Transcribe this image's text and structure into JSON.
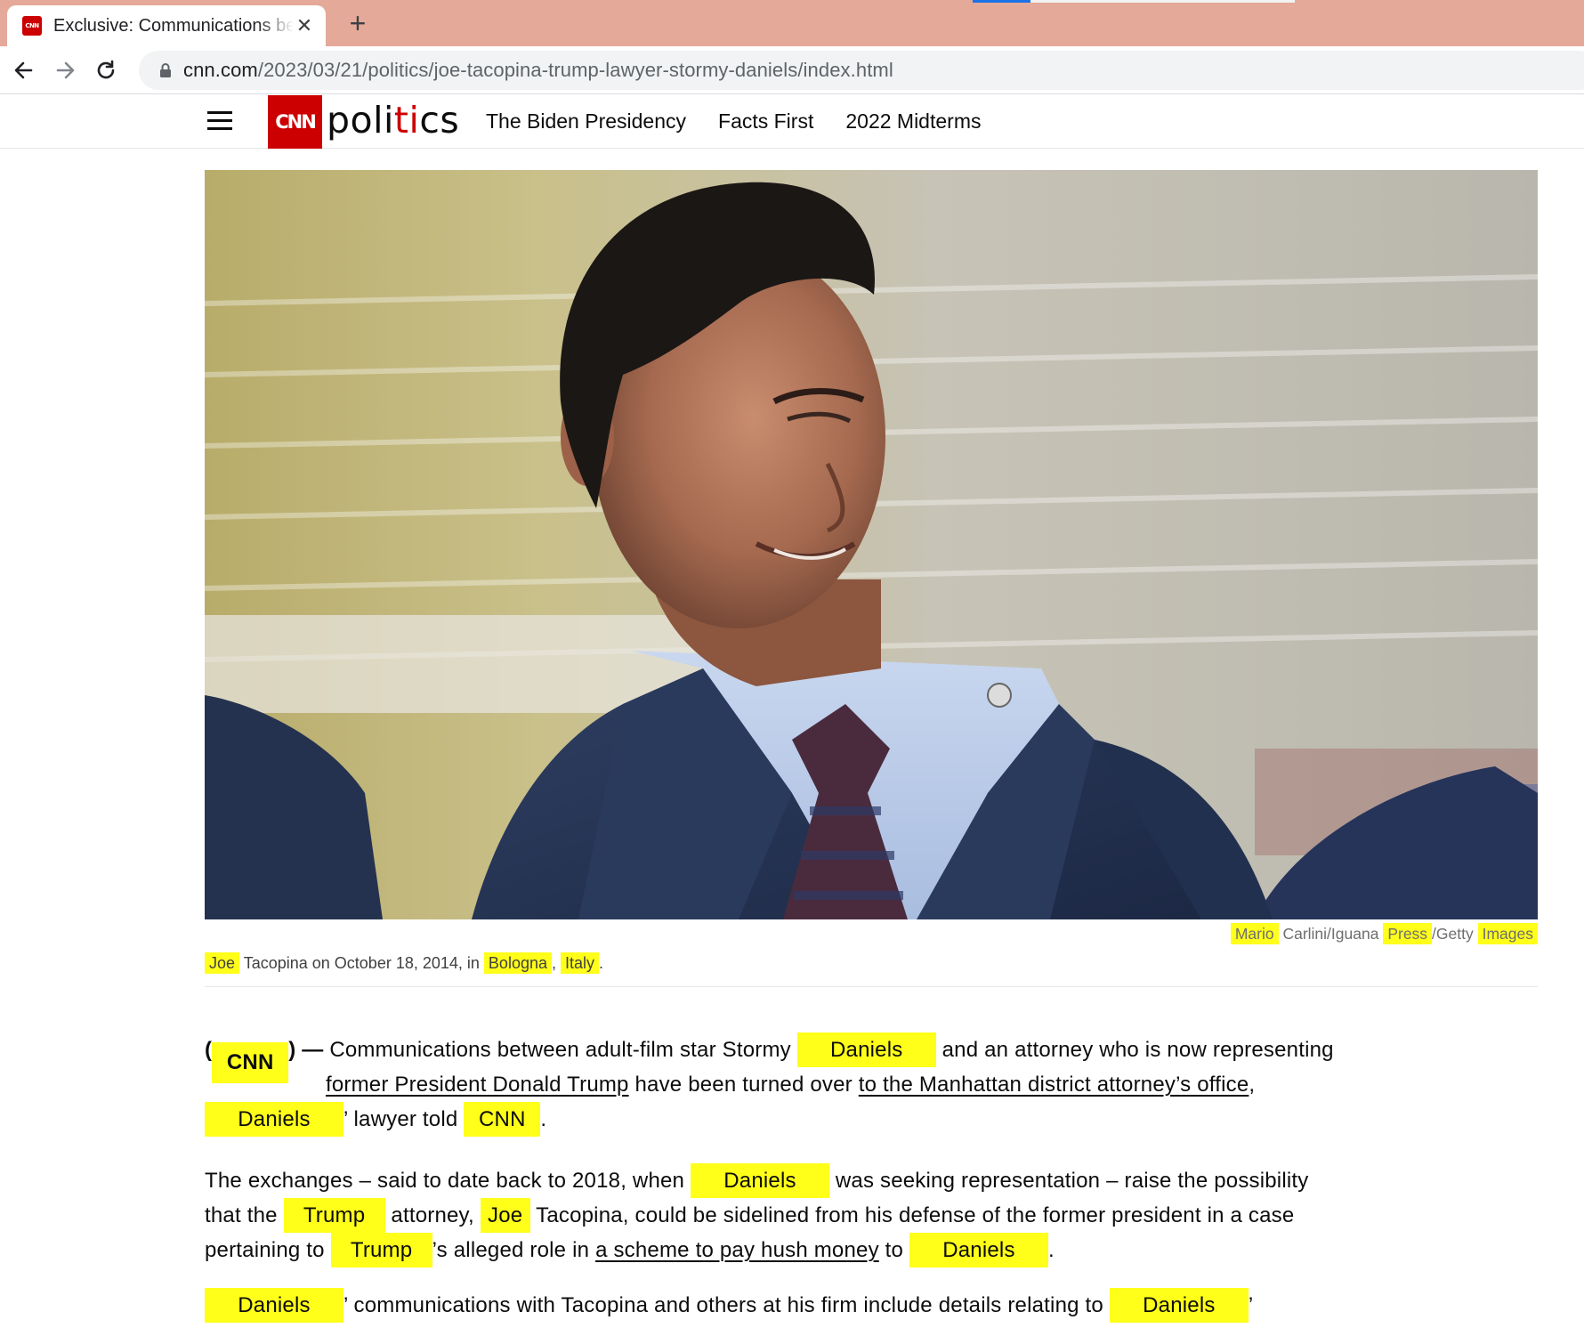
{
  "browser": {
    "tab_title": "Exclusive: Communications between Stormy Daniels and Trump lawyer",
    "favicon_text": "CNN",
    "close_glyph": "✕",
    "new_tab_glyph": "+",
    "url_host": "cnn.com",
    "url_path": "/2023/03/21/politics/joe-tacopina-trump-lawyer-stormy-daniels/index.html",
    "page_load_progress": 0.18
  },
  "header": {
    "logo_text": "CNN",
    "section_prefix": "poli",
    "section_accent": "ti",
    "section_suffix": "cs",
    "nav": [
      "The Biden Presidency",
      "Facts First",
      "2022 Midterms"
    ],
    "brand_color": "#cc0000"
  },
  "figure": {
    "credit": {
      "w1": "Mario",
      "w2": "Carlini/Iguana",
      "w3": "Press",
      "w4": "/Getty",
      "w5": "Images"
    },
    "caption": {
      "w1": "Joe",
      "w2": "Tacopina on October 18, 2014, in",
      "w3": "Bologna",
      "w4": ",",
      "w5": "Italy",
      "w6": "."
    }
  },
  "article": {
    "p1": {
      "paren_open": "(",
      "cnn": "CNN",
      "paren_close_dash": ") —",
      "t1": "Communications between adult-film star Stormy",
      "n1": "Daniels",
      "t2": "and an attorney who is now representing",
      "link1": "former President Donald Trump",
      "t3": "have been turned over",
      "link2": "to the Manhattan district attorney’s office",
      "t4": ",",
      "n2": "Daniels",
      "t5": "’ lawyer told",
      "n3": "CNN",
      "t6": "."
    },
    "p2": {
      "t1": "The exchanges – said to date back to 2018, when",
      "n1": "Daniels",
      "t2": "was seeking representation – raise the possibility",
      "t3": "that the",
      "n2": "Trump",
      "t4": "attorney,",
      "n3": "Joe",
      "t5": "Tacopina, could be sidelined from his defense of the former president in a case",
      "t6": "pertaining to",
      "n4": "Trump",
      "t7": "’s alleged role in",
      "link1": "a scheme to pay hush money",
      "t8": "to",
      "n5": "Daniels",
      "t9": "."
    },
    "p3": {
      "n1": "Daniels",
      "t1": "’ communications with Tacopina and others at his firm include details relating to",
      "n2": "Daniels",
      "t2": "’"
    },
    "highlight_color": "#ffff1a"
  }
}
